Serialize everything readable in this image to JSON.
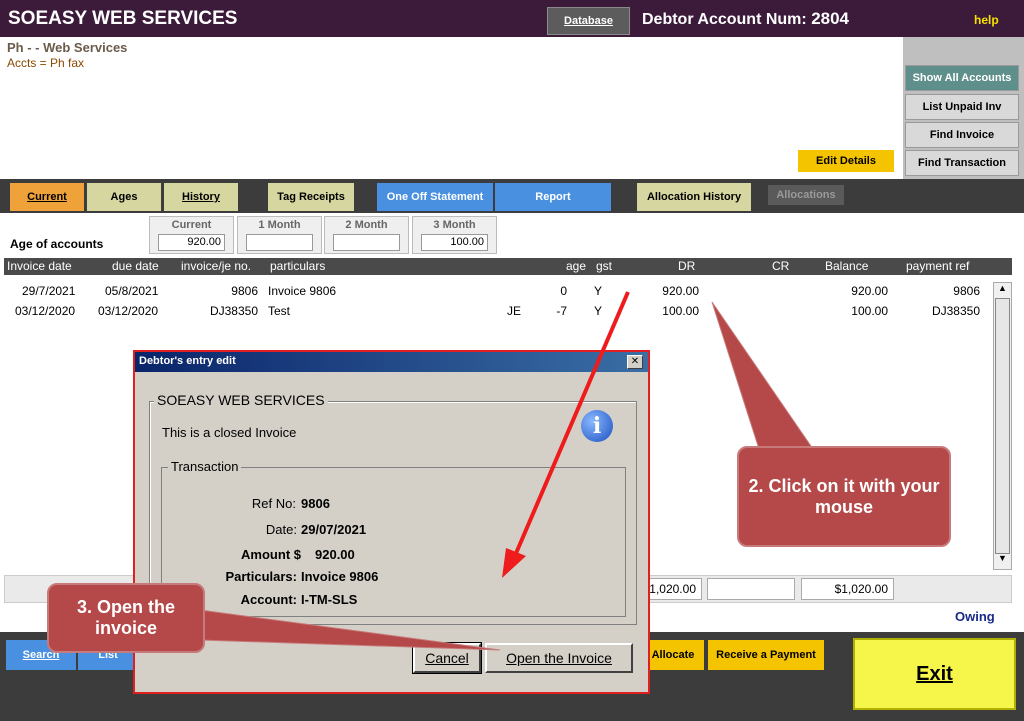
{
  "app": {
    "title": "SOEASY WEB SERVICES",
    "database_label": "Database",
    "account_label": "Debtor Account Num:",
    "account_number": "2804",
    "help_label": "help"
  },
  "header": {
    "line1": "Ph  -  - Web Services",
    "line2": "Accts =  Ph  fax"
  },
  "right_panel": {
    "show_all": "Show All Accounts",
    "list_unpaid": "List Unpaid Inv",
    "find_invoice": "Find Invoice",
    "find_transaction": "Find Transaction"
  },
  "edit_details": "Edit Details",
  "tabs": {
    "current": "Current",
    "ages": "Ages",
    "history": "History",
    "tag_receipts": "Tag Receipts",
    "one_off": "One Off Statement",
    "report": "Report",
    "allocation_history": "Allocation History",
    "allocations": "Allocations"
  },
  "ages": {
    "title": "Age of accounts",
    "current_label": "Current",
    "current_value": "920.00",
    "m1_label": "1 Month",
    "m1_value": "",
    "m2_label": "2 Month",
    "m2_value": "",
    "m3_label": "3 Month",
    "m3_value": "100.00"
  },
  "table": {
    "headers": {
      "invoice_date": "Invoice date",
      "due_date": "due date",
      "invoice_no": "invoice/je no.",
      "particulars": "particulars",
      "age": "age",
      "gst": "gst",
      "dr": "DR",
      "cr": "CR",
      "balance": "Balance",
      "payment_ref": "payment ref"
    },
    "rows": [
      {
        "invoice_date": "29/7/2021",
        "due_date": "05/8/2021",
        "invoice_no": "9806",
        "particulars": "Invoice 9806",
        "type": "",
        "age": "0",
        "gst": "Y",
        "dr": "920.00",
        "cr": "",
        "balance": "920.00",
        "payment_ref": "9806"
      },
      {
        "invoice_date": "03/12/2020",
        "due_date": "03/12/2020",
        "invoice_no": "DJ38350",
        "particulars": "Test",
        "type": "JE",
        "age": "-7",
        "gst": "Y",
        "dr": "100.00",
        "cr": "",
        "balance": "100.00",
        "payment_ref": "DJ38350"
      }
    ]
  },
  "totals": {
    "dr": "1,020.00",
    "cr": "",
    "balance": "$1,020.00",
    "owing_label": "Owing"
  },
  "bottom": {
    "search": "Search",
    "list": "List",
    "allocate": "Allocate",
    "receive": "Receive a Payment",
    "exit": "Exit"
  },
  "dialog": {
    "title": "Debtor's entry edit",
    "close": "✕",
    "company": "SOEASY WEB SERVICES",
    "message": "This is a closed Invoice",
    "info_icon": "i",
    "group_label": "Transaction",
    "ref_label": "Ref No:",
    "ref_value": "9806",
    "date_label": "Date:",
    "date_value": "29/07/2021",
    "amount_label": "Amount $",
    "amount_value": "920.00",
    "particulars_label": "Particulars:",
    "particulars_value": "Invoice 9806",
    "account_label": "Account:",
    "account_value": "I-TM-SLS",
    "cancel": "Cancel",
    "open": "Open the Invoice"
  },
  "callouts": {
    "step2": "2. Click on it with your mouse",
    "step3": "3. Open the invoice"
  },
  "colors": {
    "titlebar": "#3b1a3a",
    "accent_blue": "#4a90e0",
    "accent_yellow": "#f5c400",
    "callout": "#b54848"
  }
}
